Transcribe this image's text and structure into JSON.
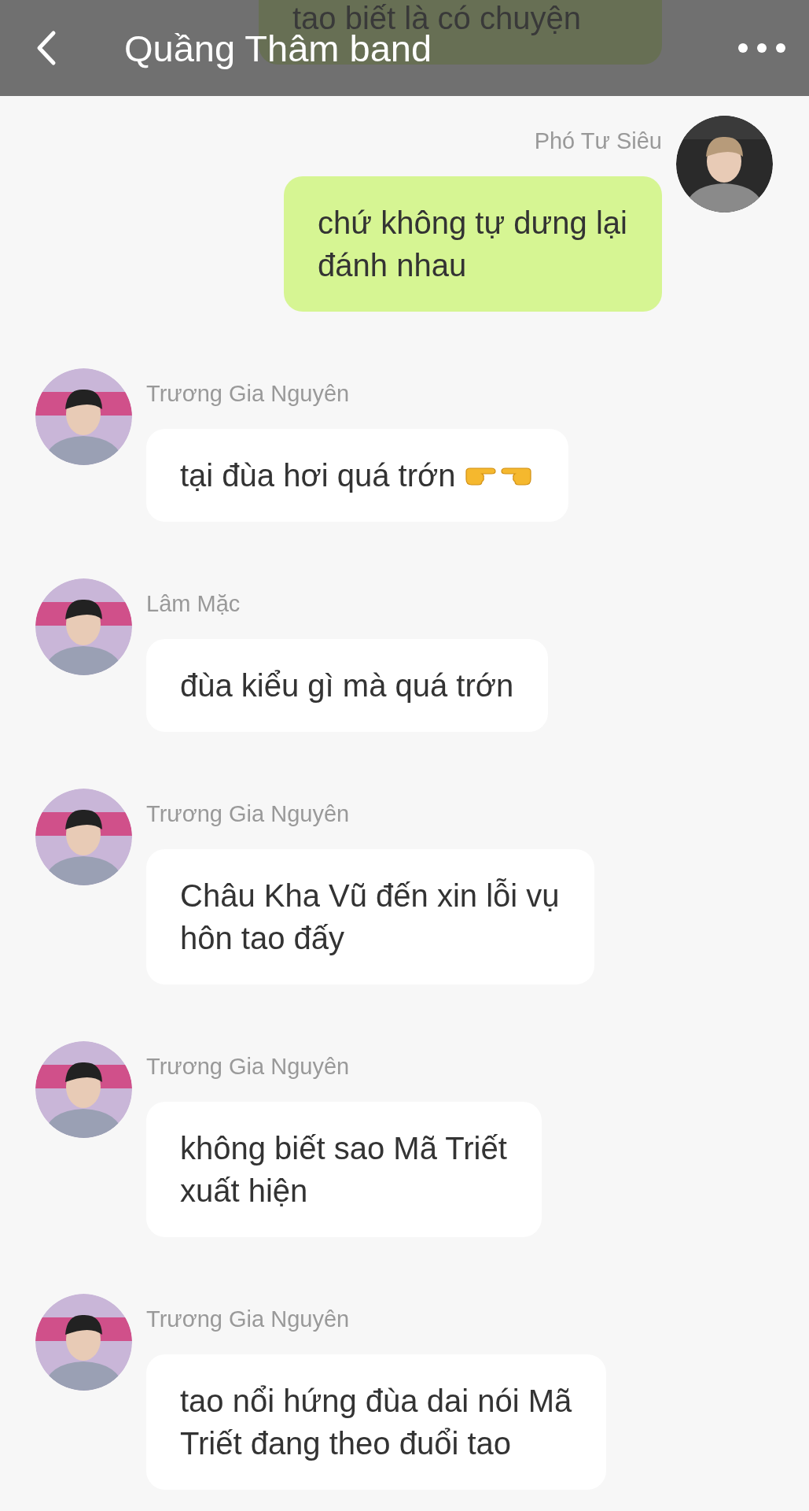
{
  "header": {
    "title": "Quầng Thâm band"
  },
  "messages": [
    {
      "outgoing": true,
      "kind": "text",
      "text": "tao biết là có chuyện"
    },
    {
      "outgoing": true,
      "kind": "text",
      "sender": "Phó Tư Siêu",
      "text": "chứ không tự dưng lại\nđánh nhau"
    },
    {
      "outgoing": false,
      "kind": "text_with_hands",
      "sender": "Trương Gia Nguyên",
      "text": "tại đùa hơi quá trớn"
    },
    {
      "outgoing": false,
      "kind": "text",
      "sender": "Lâm Mặc",
      "text": "đùa kiểu gì mà quá trớn"
    },
    {
      "outgoing": false,
      "kind": "text",
      "sender": "Trương Gia Nguyên",
      "text": "Châu Kha Vũ đến xin lỗi vụ\nhôn tao đấy"
    },
    {
      "outgoing": false,
      "kind": "text",
      "sender": "Trương Gia Nguyên",
      "text": "không biết sao Mã Triết\nxuất hiện"
    },
    {
      "outgoing": false,
      "kind": "text",
      "sender": "Trương Gia Nguyên",
      "text": "tao nổi hứng đùa dai nói Mã\nTriết đang theo đuổi tao"
    }
  ]
}
